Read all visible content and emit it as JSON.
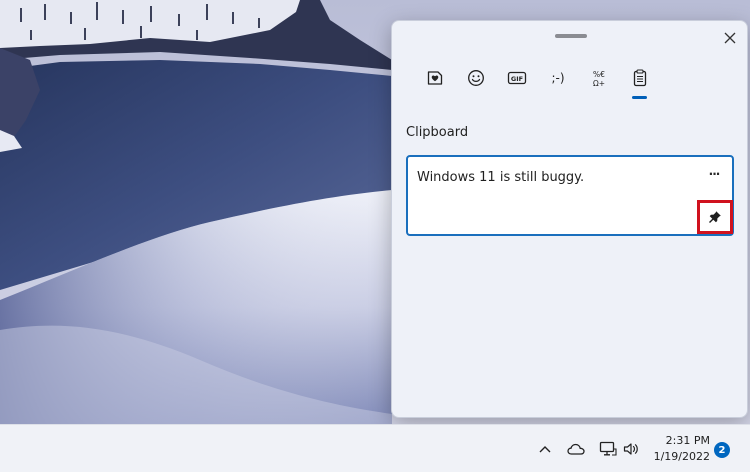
{
  "clipboard_panel": {
    "tabs": [
      {
        "id": "stickers",
        "icon": "heart-sticker-icon",
        "selected": false
      },
      {
        "id": "emoji",
        "icon": "smiley-icon",
        "selected": false
      },
      {
        "id": "gif",
        "icon": "gif-icon",
        "label": "GIF",
        "selected": false
      },
      {
        "id": "kaomoji",
        "icon": "kaomoji-icon",
        "label": ";-)",
        "selected": false
      },
      {
        "id": "symbols",
        "icon": "symbols-icon",
        "label": "%€\nΩ+",
        "selected": false
      },
      {
        "id": "clipboard",
        "icon": "clipboard-icon",
        "selected": true
      }
    ],
    "section_title": "Clipboard",
    "items": [
      {
        "text": "Windows 11 is still buggy.",
        "more_label": "···",
        "pinned": false
      }
    ],
    "accent_color": "#005fb8",
    "highlight_color": "#d0121e"
  },
  "taskbar": {
    "tray_icons": [
      "chevron-up-icon",
      "onedrive-cloud-icon",
      "network-monitor-icon",
      "speaker-icon"
    ],
    "time": "2:31 PM",
    "date": "1/19/2022",
    "notification_count": "2"
  }
}
